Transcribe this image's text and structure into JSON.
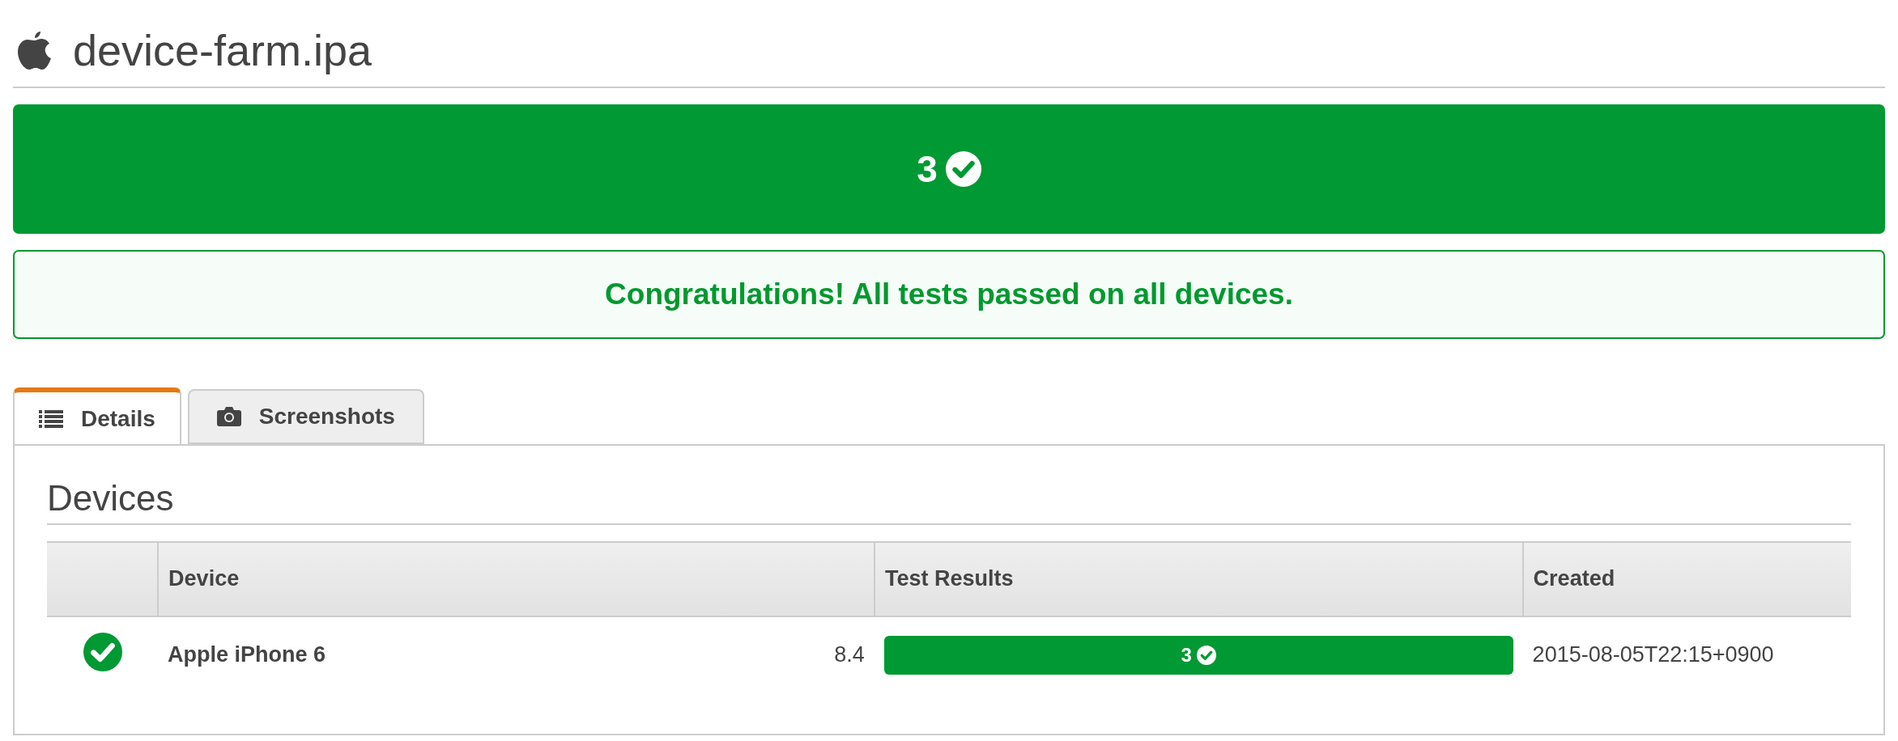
{
  "title": "device-farm.ipa",
  "summary": {
    "passed": true,
    "count": "3"
  },
  "message": {
    "passed": true,
    "text": "Congratulations! All tests passed on all devices."
  },
  "tabs": [
    {
      "label": "Details",
      "selected": true
    },
    {
      "label": "Screenshots",
      "selected": false
    }
  ],
  "section_title": "Devices",
  "table": {
    "columns": [
      "Device",
      "Test Results",
      "Created"
    ],
    "rows": [
      {
        "passed": true,
        "device": "Apple iPhone 6",
        "os_version": "8.4",
        "result": {
          "passed": true,
          "count": "3"
        },
        "created": "2015-08-05T22:15+0900"
      }
    ]
  }
}
